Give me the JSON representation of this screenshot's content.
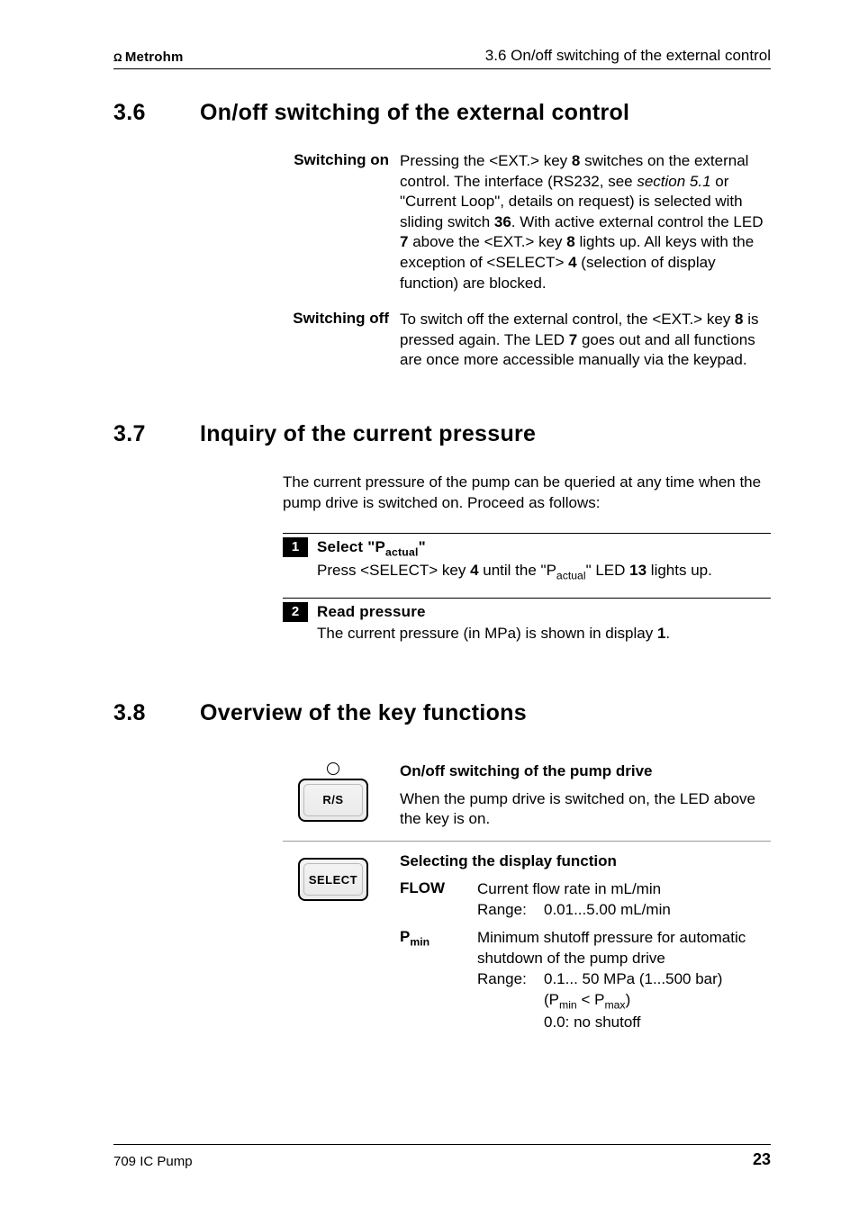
{
  "header": {
    "brand": "Metrohm",
    "breadcrumb": "3.6  On/off switching of the external control"
  },
  "sections": {
    "s36": {
      "num": "3.6",
      "title": "On/off switching of the external control",
      "rows": [
        {
          "term": "Switching on",
          "html": "Pressing the &lt;EXT.&gt; key <b class='hv'>8</b> switches on the external control. The interface (RS232, see <i>section 5.1</i> or \"Current Loop\", details on request) is selected with sliding switch <b class='hv'>36</b>. With active external control the LED <b class='hv'>7</b> above the &lt;EXT.&gt; key <b class='hv'>8</b> lights up. All keys with the exception of &lt;SELECT&gt; <b class='hv'>4</b> (selection of display function) are blocked."
        },
        {
          "term": "Switching off",
          "html": "To switch off the external control, the &lt;EXT.&gt; key <b class='hv'>8</b> is pressed again. The LED <b class='hv'>7</b> goes out and all functions are once more accessible manually via the keypad."
        }
      ]
    },
    "s37": {
      "num": "3.7",
      "title": "Inquiry of the current pressure",
      "intro": "The current pressure of the pump can be queried at any time when the pump drive is switched on. Proceed as follows:",
      "steps": [
        {
          "n": "1",
          "title_html": "Select \"P<span class='sub'>actual</span>\"",
          "body_html": "Press &lt;SELECT&gt; key <b class='hv'>4</b> until the \"P<span class='sub'>actual</span>\" LED <b class='hv'>13</b> lights up."
        },
        {
          "n": "2",
          "title_html": "Read pressure",
          "body_html": "The current pressure (in MPa) is shown in display <b class='hv'>1</b>."
        }
      ]
    },
    "s38": {
      "num": "3.8",
      "title": "Overview of the key functions",
      "keys": [
        {
          "key_label": "R/S",
          "has_led": true,
          "title": "On/off switching of the pump drive",
          "body": "When the pump drive is switched on, the LED above the key is on."
        },
        {
          "key_label": "SELECT",
          "has_led": false,
          "title": "Selecting the display function",
          "params": [
            {
              "label": "FLOW",
              "desc": "Current flow rate in mL/min",
              "range_label": "Range:",
              "range": "0.01...5.00 mL/min"
            },
            {
              "label_html": "P<span class='sub'>min</span>",
              "desc": "Minimum shutoff pressure for automatic shutdown of the pump drive",
              "range_label": "Range:",
              "range": "0.1... 50 MPa (1...500 bar)",
              "extra_html": "(P<span class='sub'>min</span> &lt; P<span class='sub'>max</span>)",
              "extra2": "0.0:  no shutoff"
            }
          ]
        }
      ]
    }
  },
  "footer": {
    "product": "709 IC Pump",
    "page": "23"
  }
}
